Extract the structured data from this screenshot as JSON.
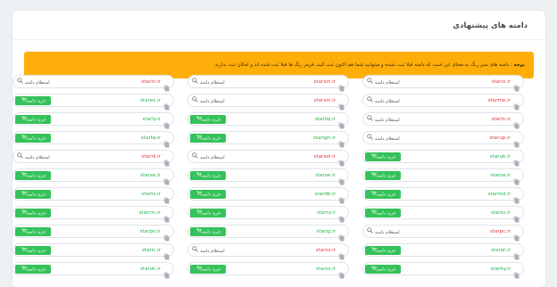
{
  "card": {
    "title": "دامنه های پیشنهادی"
  },
  "notice": {
    "label": "توجه",
    "text": ": دامنه های سبز رنگ به معنای این است که دامنه قبلا ثبت نشده و میتوانید شما هم اکنون ثبت کنید، قرمز رنگ ها قبلا ثبت شده اند و امکان ثبت ندارند."
  },
  "labels": {
    "buy": "خرید دامنه",
    "whois": "استعلام دامنه"
  },
  "colors": {
    "available": "#2ab34d",
    "taken": "#e23b3b",
    "notice_bg": "#ffad09",
    "buy_bg": "#35c25a"
  },
  "rows": [
    [
      {
        "name": "starin.ir",
        "status": "taken"
      },
      {
        "name": "starsin.ir",
        "status": "taken"
      },
      {
        "name": "starix.ir",
        "status": "taken"
      }
    ],
    [
      {
        "name": "starex.ir",
        "status": "available"
      },
      {
        "name": "starsin.ir",
        "status": "taken"
      },
      {
        "name": "starme.ir",
        "status": "taken"
      }
    ],
    [
      {
        "name": "starly.ir",
        "status": "available"
      },
      {
        "name": "starliq.ir",
        "status": "available"
      },
      {
        "name": "starin.ir",
        "status": "taken"
      }
    ],
    [
      {
        "name": "starlw.ir",
        "status": "available"
      },
      {
        "name": "starlgn.ir",
        "status": "available"
      },
      {
        "name": "starup.ir",
        "status": "taken"
      }
    ],
    [
      {
        "name": "starid.ir",
        "status": "taken"
      },
      {
        "name": "starsel.ir",
        "status": "taken"
      },
      {
        "name": "staruk.ir",
        "status": "available"
      }
    ],
    [
      {
        "name": "starse.ir",
        "status": "available"
      },
      {
        "name": "starse.ir",
        "status": "available"
      },
      {
        "name": "starsa.ir",
        "status": "available"
      }
    ],
    [
      {
        "name": "starts.ir",
        "status": "available"
      },
      {
        "name": "stardb.ir",
        "status": "available"
      },
      {
        "name": "starmd.ir",
        "status": "available"
      }
    ],
    [
      {
        "name": "starcin.ir",
        "status": "available"
      },
      {
        "name": "starry.ir",
        "status": "available"
      },
      {
        "name": "starss.ir",
        "status": "available"
      }
    ],
    [
      {
        "name": "starpo.ir",
        "status": "available"
      },
      {
        "name": "starig.ir",
        "status": "available"
      },
      {
        "name": "starpc.ir",
        "status": "taken"
      }
    ],
    [
      {
        "name": "staric.ir",
        "status": "available"
      },
      {
        "name": "starss.ir",
        "status": "taken"
      },
      {
        "name": "starat.ir",
        "status": "available"
      }
    ],
    [
      {
        "name": "starok.ir",
        "status": "available"
      },
      {
        "name": "starss.ir",
        "status": "available"
      },
      {
        "name": "starby.ir",
        "status": "available"
      }
    ]
  ]
}
